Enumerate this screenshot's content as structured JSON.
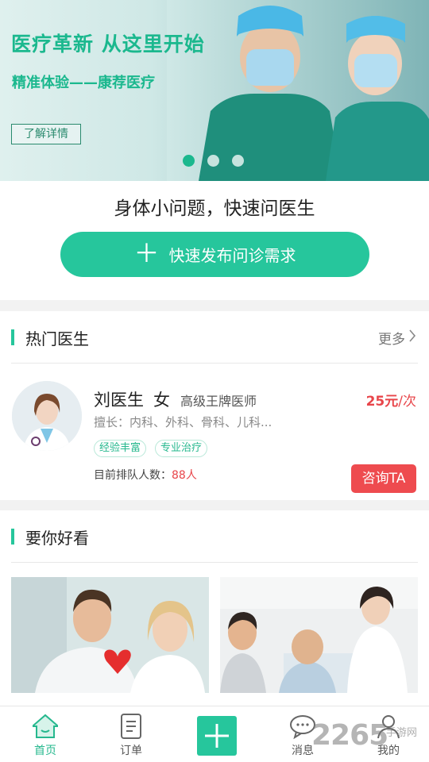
{
  "banner": {
    "title": "医疗革新  从这里开始",
    "subtitle": "精准体验——康荐医疗",
    "learn_more": "了解详情",
    "dots": [
      true,
      false,
      false
    ]
  },
  "quick_ask": {
    "title": "身体小问题，快速问医生",
    "button_label": "快速发布问诊需求"
  },
  "hot_doctors": {
    "header": "热门医生",
    "more": "更多",
    "doctor": {
      "name": "刘医生",
      "gender": "女",
      "level": "高级王牌医师",
      "price_value": "25元",
      "price_unit": "/次",
      "specialty": "擅长：内科、外科、骨科、儿科...",
      "tags": [
        "经验丰富",
        "专业治疗"
      ],
      "queue_label": "目前排队人数：",
      "queue_count": "88人",
      "consult_button": "咨询TA"
    }
  },
  "recommend": {
    "header": "要你好看"
  },
  "bottom_nav": {
    "items": [
      {
        "label": "首页",
        "icon": "home-icon",
        "active": true
      },
      {
        "label": "订单",
        "icon": "order-icon",
        "active": false
      },
      {
        "label": "",
        "icon": "add-icon",
        "active": false
      },
      {
        "label": "消息",
        "icon": "message-icon",
        "active": false
      },
      {
        "label": "我的",
        "icon": "profile-icon",
        "active": false
      }
    ]
  },
  "watermark": {
    "text": "2265",
    "sub": "手游网"
  },
  "colors": {
    "accent": "#26c69c",
    "price": "#e8454a",
    "consult": "#ee4b4f"
  }
}
